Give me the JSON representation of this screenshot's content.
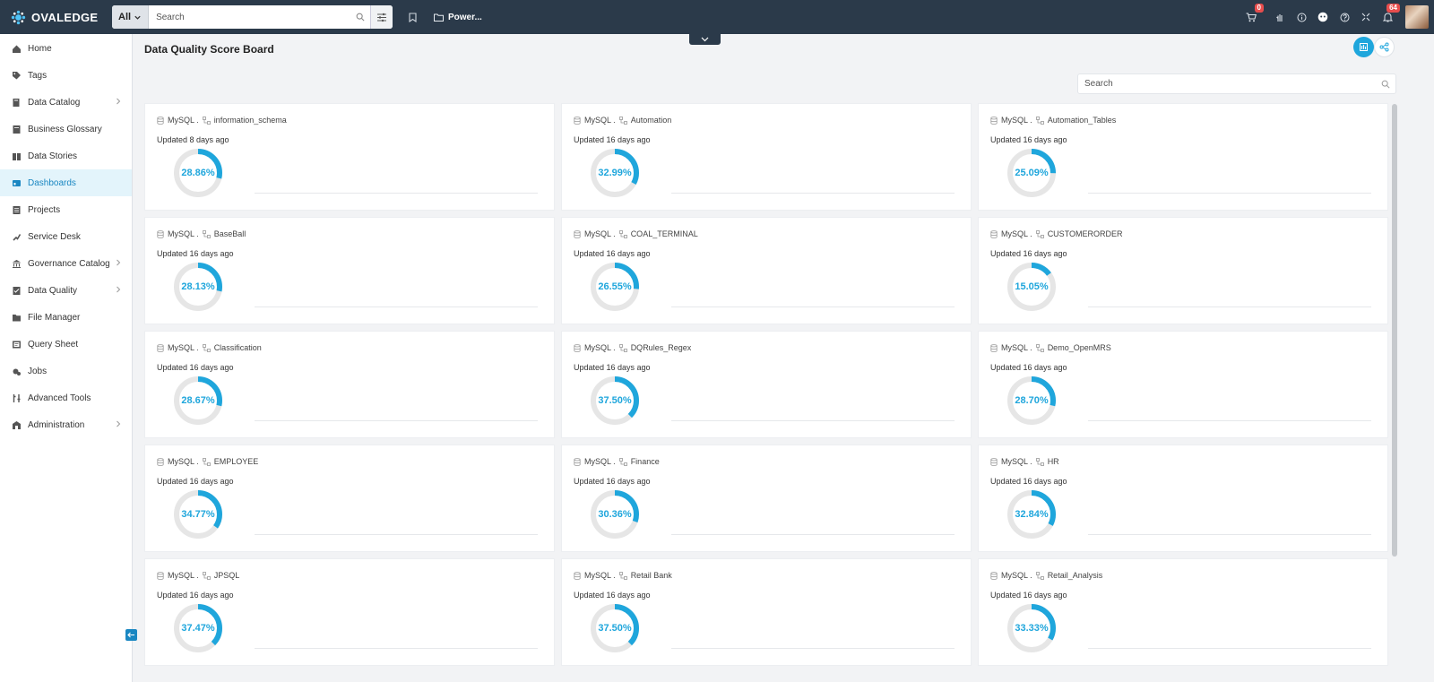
{
  "app": {
    "logo_text": "OVALEDGE"
  },
  "topbar": {
    "search_scope": "All",
    "search_placeholder": "Search",
    "workspace_label": "Power...",
    "cart_count": "0",
    "notification_count": "64"
  },
  "sidebar": {
    "items": [
      {
        "label": "Home",
        "icon": "home-icon",
        "has_children": false,
        "active": false
      },
      {
        "label": "Tags",
        "icon": "tag-icon",
        "has_children": false,
        "active": false
      },
      {
        "label": "Data Catalog",
        "icon": "catalog-icon",
        "has_children": true,
        "active": false
      },
      {
        "label": "Business Glossary",
        "icon": "glossary-icon",
        "has_children": false,
        "active": false
      },
      {
        "label": "Data Stories",
        "icon": "book-icon",
        "has_children": false,
        "active": false
      },
      {
        "label": "Dashboards",
        "icon": "dashboard-icon",
        "has_children": false,
        "active": true
      },
      {
        "label": "Projects",
        "icon": "projects-icon",
        "has_children": false,
        "active": false
      },
      {
        "label": "Service Desk",
        "icon": "service-desk-icon",
        "has_children": false,
        "active": false
      },
      {
        "label": "Governance Catalog",
        "icon": "governance-icon",
        "has_children": true,
        "active": false
      },
      {
        "label": "Data Quality",
        "icon": "data-quality-icon",
        "has_children": true,
        "active": false
      },
      {
        "label": "File Manager",
        "icon": "folder-icon",
        "has_children": false,
        "active": false
      },
      {
        "label": "Query Sheet",
        "icon": "query-icon",
        "has_children": false,
        "active": false
      },
      {
        "label": "Jobs",
        "icon": "jobs-icon",
        "has_children": false,
        "active": false
      },
      {
        "label": "Advanced Tools",
        "icon": "tools-icon",
        "has_children": false,
        "active": false
      },
      {
        "label": "Administration",
        "icon": "admin-icon",
        "has_children": true,
        "active": false
      }
    ]
  },
  "main": {
    "title": "Data Quality Score Board",
    "search_placeholder": "Search",
    "accent_color": "#1fa6dc",
    "cards": [
      {
        "source": "MySQL .",
        "schema": "information_schema",
        "updated": "Updated 8 days ago",
        "score_text": "28.86%",
        "score": 28.86
      },
      {
        "source": "MySQL .",
        "schema": "Automation",
        "updated": "Updated 16 days ago",
        "score_text": "32.99%",
        "score": 32.99
      },
      {
        "source": "MySQL .",
        "schema": "Automation_Tables",
        "updated": "Updated 16 days ago",
        "score_text": "25.09%",
        "score": 25.09
      },
      {
        "source": "MySQL .",
        "schema": "BaseBall",
        "updated": "Updated 16 days ago",
        "score_text": "28.13%",
        "score": 28.13
      },
      {
        "source": "MySQL .",
        "schema": "COAL_TERMINAL",
        "updated": "Updated 16 days ago",
        "score_text": "26.55%",
        "score": 26.55
      },
      {
        "source": "MySQL .",
        "schema": "CUSTOMERORDER",
        "updated": "Updated 16 days ago",
        "score_text": "15.05%",
        "score": 15.05
      },
      {
        "source": "MySQL .",
        "schema": "Classification",
        "updated": "Updated 16 days ago",
        "score_text": "28.67%",
        "score": 28.67
      },
      {
        "source": "MySQL .",
        "schema": "DQRules_Regex",
        "updated": "Updated 16 days ago",
        "score_text": "37.50%",
        "score": 37.5
      },
      {
        "source": "MySQL .",
        "schema": "Demo_OpenMRS",
        "updated": "Updated 16 days ago",
        "score_text": "28.70%",
        "score": 28.7
      },
      {
        "source": "MySQL .",
        "schema": "EMPLOYEE",
        "updated": "Updated 16 days ago",
        "score_text": "34.77%",
        "score": 34.77
      },
      {
        "source": "MySQL .",
        "schema": "Finance",
        "updated": "Updated 16 days ago",
        "score_text": "30.36%",
        "score": 30.36
      },
      {
        "source": "MySQL .",
        "schema": "HR",
        "updated": "Updated 16 days ago",
        "score_text": "32.84%",
        "score": 32.84
      },
      {
        "source": "MySQL .",
        "schema": "JPSQL",
        "updated": "Updated 16 days ago",
        "score_text": "37.47%",
        "score": 37.47
      },
      {
        "source": "MySQL .",
        "schema": "Retail Bank",
        "updated": "Updated 16 days ago",
        "score_text": "37.50%",
        "score": 37.5
      },
      {
        "source": "MySQL .",
        "schema": "Retail_Analysis",
        "updated": "Updated 16 days ago",
        "score_text": "33.33%",
        "score": 33.33
      }
    ]
  }
}
